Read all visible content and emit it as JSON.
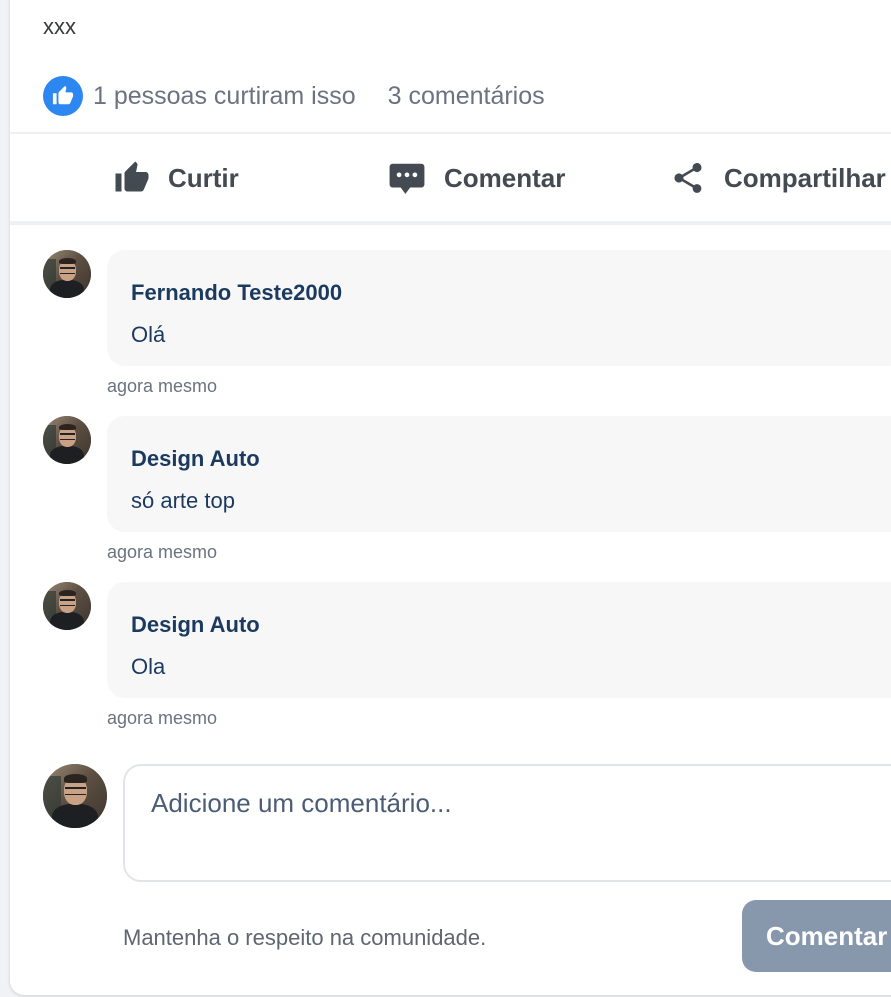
{
  "post": {
    "text": "xxx"
  },
  "stats": {
    "likes_text": "1 pessoas curtiram isso",
    "comments_text": "3 comentários"
  },
  "actions": {
    "like": "Curtir",
    "comment": "Comentar",
    "share": "Compartilhar"
  },
  "comments": [
    {
      "author": "Fernando Teste2000",
      "text": "Olá",
      "time": "agora mesmo"
    },
    {
      "author": "Design Auto",
      "text": "só arte top",
      "time": "agora mesmo"
    },
    {
      "author": "Design Auto",
      "text": "Ola",
      "time": "agora mesmo"
    }
  ],
  "composer": {
    "placeholder": "Adicione um comentário...",
    "value": "",
    "rules_text": "Mantenha o respeito na comunidade.",
    "submit_label": "Comentar"
  },
  "colors": {
    "like_badge": "#2d87f0",
    "accent_text": "#1c3a5e",
    "submit_disabled": "#8798ad"
  },
  "icons": {
    "like_badge": "thumbs-up-icon",
    "like": "thumbs-up-icon",
    "comment": "comment-icon",
    "share": "share-icon"
  }
}
